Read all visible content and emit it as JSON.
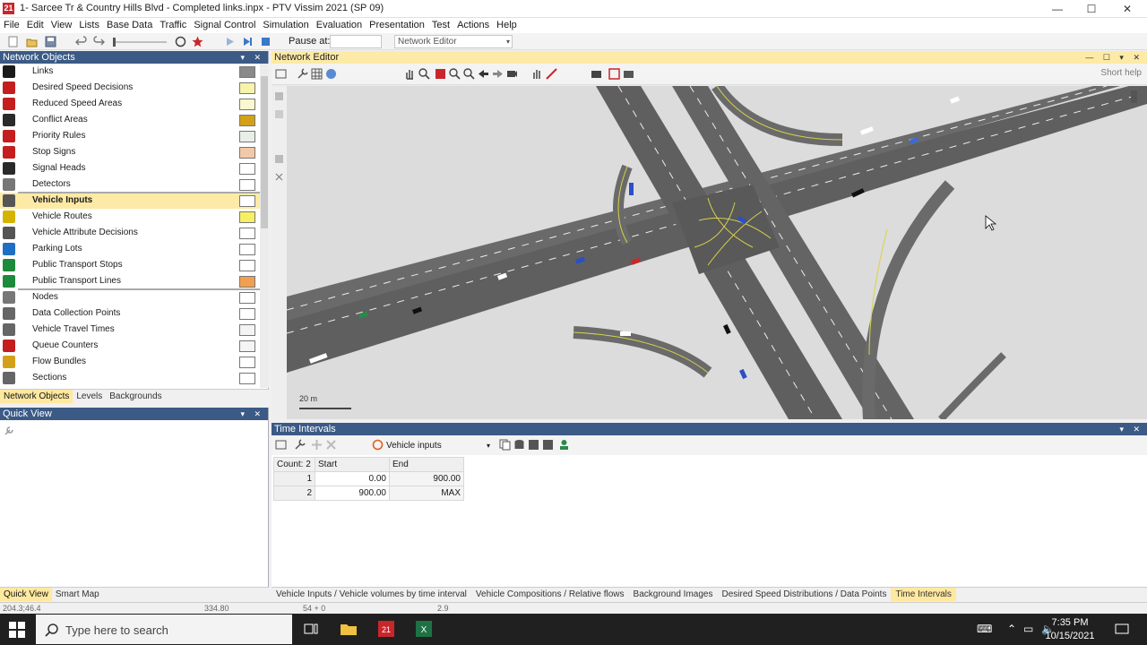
{
  "window": {
    "title": "1- Sarcee Tr & Country Hills Blvd - Completed links.inpx - PTV Vissim 2021 (SP 09)",
    "app_icon": "21",
    "minimize": "—",
    "maximize": "☐",
    "close": "✕"
  },
  "menu": [
    "File",
    "Edit",
    "View",
    "Lists",
    "Base Data",
    "Traffic",
    "Signal Control",
    "Simulation",
    "Evaluation",
    "Presentation",
    "Test",
    "Actions",
    "Help"
  ],
  "toolbar": {
    "pause_label": "Pause at:",
    "pause_value": "",
    "editor_selected": "Network Editor"
  },
  "network_objects": {
    "title": "Network Objects",
    "items": [
      {
        "label": "Links",
        "icon": "links-icon",
        "color": "#1b1b1b",
        "swatch": "#8a8a8a"
      },
      {
        "label": "Desired Speed Decisions",
        "icon": "speed-limit-icon",
        "color": "#c41e1e",
        "swatch": "#f7f3a8"
      },
      {
        "label": "Reduced Speed Areas",
        "icon": "warning-triangle-icon",
        "color": "#c41e1e",
        "swatch": "#fbf8cf"
      },
      {
        "label": "Conflict Areas",
        "icon": "conflict-area-icon",
        "color": "#2a2a2a",
        "swatch": "#d4a017"
      },
      {
        "label": "Priority Rules",
        "icon": "yield-icon",
        "color": "#c41e1e",
        "swatch": "#e8efe8"
      },
      {
        "label": "Stop Signs",
        "icon": "stop-sign-icon",
        "color": "#c41e1e",
        "swatch": "#f3c8a8"
      },
      {
        "label": "Signal Heads",
        "icon": "traffic-light-icon",
        "color": "#2a2a2a",
        "swatch": "#ffffff"
      },
      {
        "label": "Detectors",
        "icon": "detector-icon",
        "color": "#777777",
        "swatch": "#ffffff"
      },
      {
        "label": "Vehicle Inputs",
        "icon": "vehicle-input-icon",
        "color": "#555555",
        "swatch": "#ffffff",
        "selected": true
      },
      {
        "label": "Vehicle Routes",
        "icon": "route-icon",
        "color": "#d4b400",
        "swatch": "#f7ef62"
      },
      {
        "label": "Vehicle Attribute Decisions",
        "icon": "attribute-decision-icon",
        "color": "#555555",
        "swatch": "#ffffff"
      },
      {
        "label": "Parking Lots",
        "icon": "parking-icon",
        "color": "#1e6fc4",
        "swatch": "#ffffff"
      },
      {
        "label": "Public Transport Stops",
        "icon": "bus-stop-icon",
        "color": "#1e8a3c",
        "swatch": "#ffffff"
      },
      {
        "label": "Public Transport Lines",
        "icon": "bus-line-icon",
        "color": "#1e8a3c",
        "swatch": "#f0a050"
      },
      {
        "label": "Nodes",
        "icon": "node-icon",
        "color": "#777777",
        "swatch": "#ffffff"
      },
      {
        "label": "Data Collection Points",
        "icon": "data-point-icon",
        "color": "#666666",
        "swatch": "#ffffff"
      },
      {
        "label": "Vehicle Travel Times",
        "icon": "stopwatch-icon",
        "color": "#666666",
        "swatch": "#f4f4f4"
      },
      {
        "label": "Queue Counters",
        "icon": "queue-counter-icon",
        "color": "#c41e1e",
        "swatch": "#f4f4f4"
      },
      {
        "label": "Flow Bundles",
        "icon": "flow-bundle-icon",
        "color": "#d4a017",
        "swatch": "#ffffff"
      },
      {
        "label": "Sections",
        "icon": "section-icon",
        "color": "#666666",
        "swatch": "#ffffff"
      }
    ],
    "tabs": [
      "Network Objects",
      "Levels",
      "Backgrounds"
    ]
  },
  "quick_view": {
    "title": "Quick View",
    "tabs": [
      "Quick View",
      "Smart Map"
    ]
  },
  "network_editor": {
    "title": "Network Editor",
    "short_help": "Short help",
    "scale_label": "20 m"
  },
  "time_intervals": {
    "title": "Time Intervals",
    "list_selector": "Vehicle inputs",
    "count_label": "Count: 2",
    "columns": [
      "Start",
      "End"
    ],
    "rows": [
      {
        "num": "1",
        "start": "0.00",
        "end": "900.00"
      },
      {
        "num": "2",
        "start": "900.00",
        "end": "MAX"
      }
    ]
  },
  "bottom_tabs": [
    "Vehicle Inputs / Vehicle volumes by time interval",
    "Vehicle Compositions / Relative flows",
    "Background Images",
    "Desired Speed Distributions / Data Points",
    "Time Intervals"
  ],
  "status_bar": {
    "coords": "204.3;46.4",
    "value2": "334.80",
    "value3": "54 + 0",
    "value4": "2.9"
  },
  "taskbar": {
    "search_placeholder": "Type here to search",
    "time": "7:35 PM",
    "date": "10/15/2021"
  }
}
